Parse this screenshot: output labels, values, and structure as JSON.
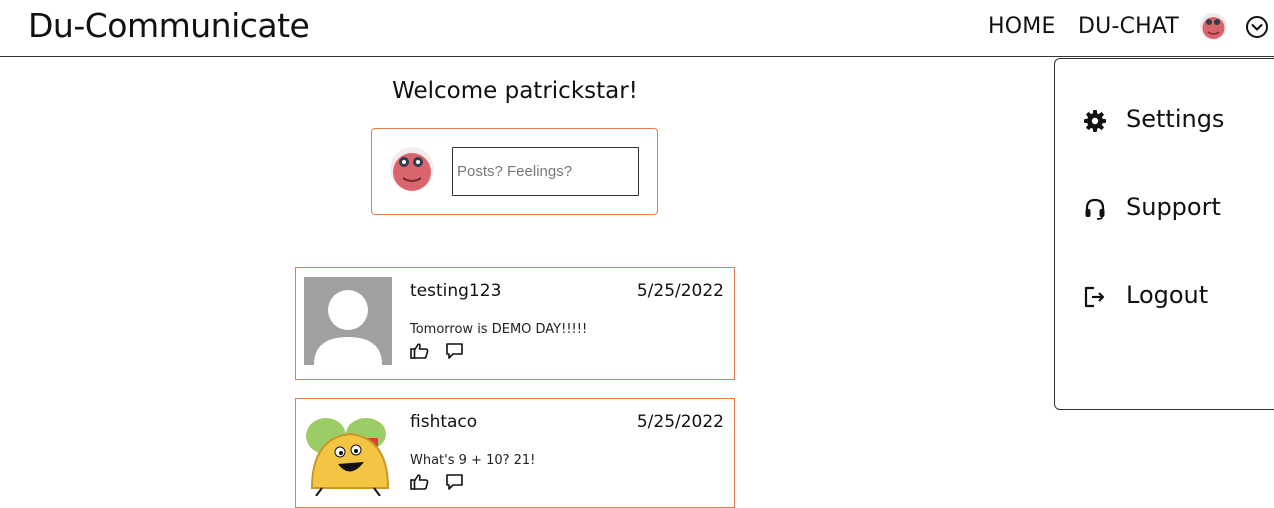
{
  "app": {
    "brand": "Du-Communicate"
  },
  "nav": {
    "links": [
      "HOME",
      "DU-CHAT"
    ],
    "avatar_icon": "user-avatar-pink",
    "menu_icon": "chevron-down-circle-icon"
  },
  "welcome": "Welcome patrickstar!",
  "composer": {
    "placeholder": "Posts? Feelings?",
    "value": ""
  },
  "posts": [
    {
      "user": "testing123",
      "date": "5/25/2022",
      "text": "Tomorrow is DEMO DAY!!!!!",
      "avatar": "default-gray-avatar"
    },
    {
      "user": "fishtaco",
      "date": "5/25/2022",
      "text": "What's 9 + 10? 21!",
      "avatar": "taco-character-avatar"
    }
  ],
  "dropdown": {
    "items": [
      {
        "label": "Settings",
        "icon": "gear-icon"
      },
      {
        "label": "Support",
        "icon": "headset-icon"
      },
      {
        "label": "Logout",
        "icon": "logout-icon"
      }
    ]
  },
  "colors": {
    "accent_border": "#e57d48",
    "text": "#111111"
  }
}
